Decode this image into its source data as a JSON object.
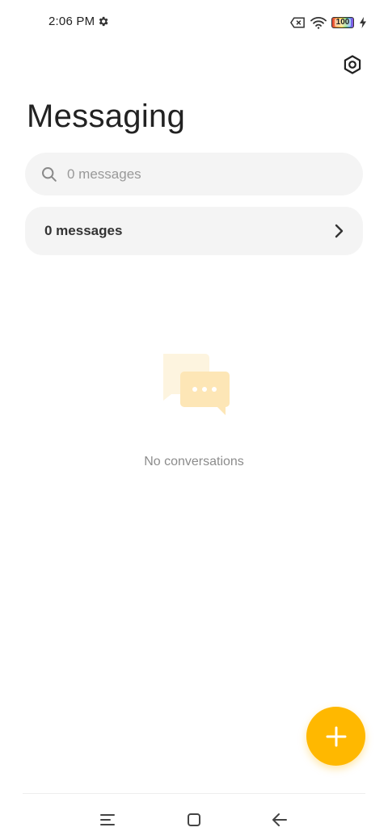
{
  "status_bar": {
    "time": "2:06 PM",
    "battery_level": "100",
    "icons": [
      "gear-icon",
      "sim-x-icon",
      "wifi-icon",
      "battery-icon",
      "charging-bolt-icon"
    ]
  },
  "header": {
    "title": "Messaging",
    "settings_icon": "settings-hexagon-icon"
  },
  "search": {
    "placeholder": "0 messages",
    "value": ""
  },
  "messages_row": {
    "label": "0 messages"
  },
  "empty_state": {
    "text": "No conversations",
    "illustration": "chat-bubbles-icon"
  },
  "fab": {
    "icon": "plus-icon",
    "color": "#ffb800"
  },
  "nav_bar": {
    "buttons": [
      "menu-icon",
      "home-square-icon",
      "back-arrow-icon"
    ]
  }
}
